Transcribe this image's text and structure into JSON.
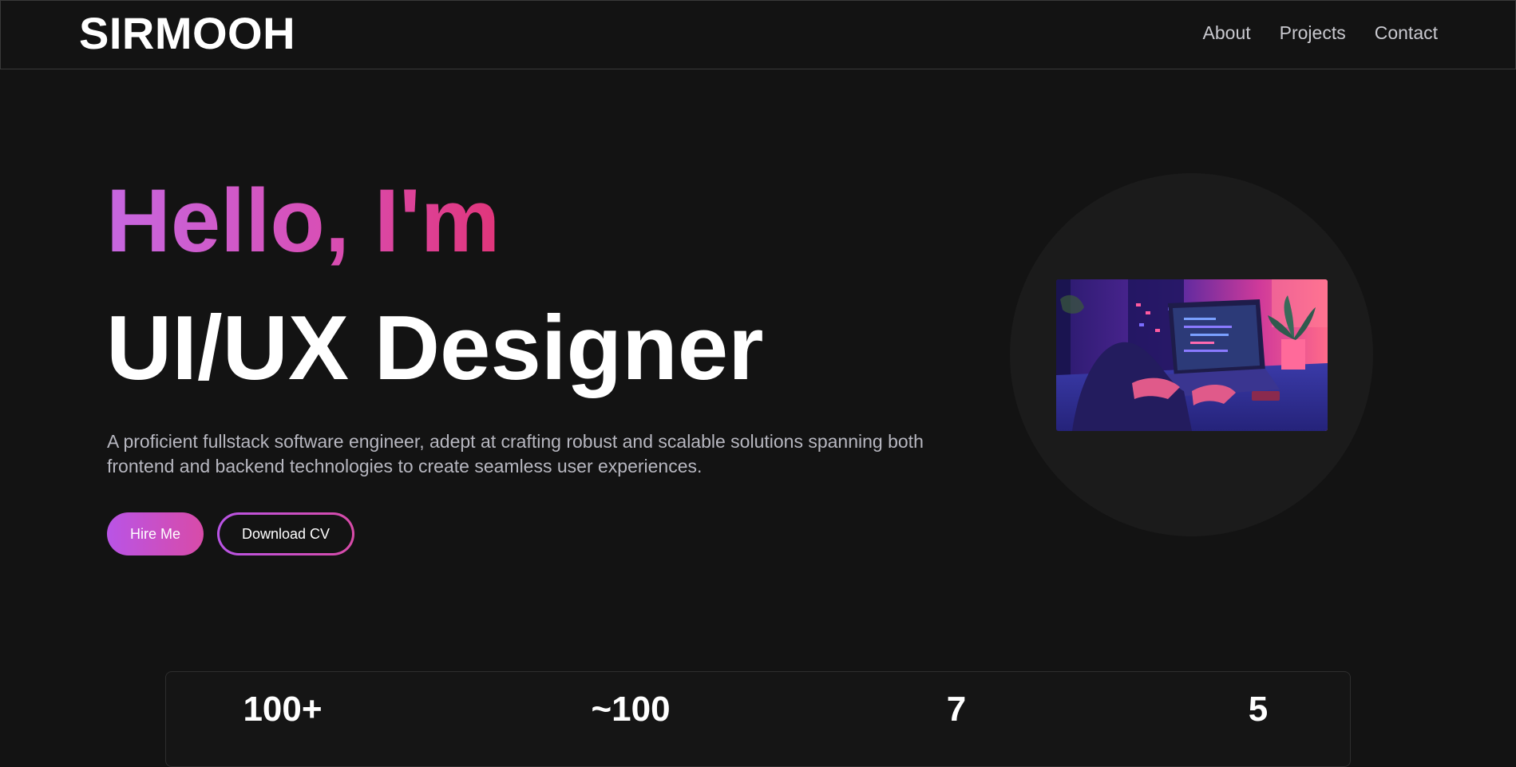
{
  "brand": "SIRMOOH",
  "nav": {
    "items": [
      {
        "label": "About"
      },
      {
        "label": "Projects"
      },
      {
        "label": "Contact"
      }
    ]
  },
  "hero": {
    "greeting": "Hello, I'm",
    "title": "UI/UX Designer",
    "description": "A proficient fullstack software engineer, adept at crafting robust and scalable solutions spanning both frontend and backend technologies to create seamless user experiences.",
    "hire_label": "Hire Me",
    "cv_label": "Download CV"
  },
  "stats": {
    "items": [
      {
        "value": "100+"
      },
      {
        "value": "~100"
      },
      {
        "value": "7"
      },
      {
        "value": "5"
      }
    ]
  },
  "colors": {
    "background": "#131313",
    "accent_start": "#b954e6",
    "accent_end": "#e1357a",
    "muted_text": "#b7b7c0"
  }
}
